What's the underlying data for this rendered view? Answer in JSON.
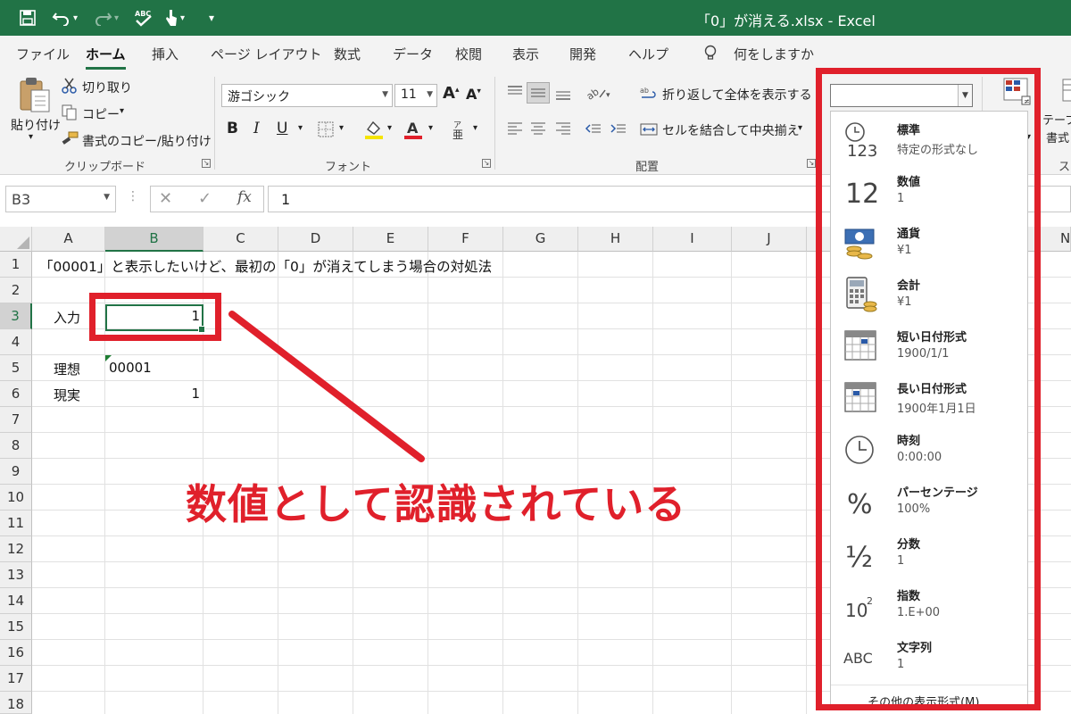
{
  "window": {
    "title": "「0」が消える.xlsx  -  Excel"
  },
  "quick_access": {
    "more": "▾"
  },
  "tabs": [
    "ファイル",
    "ホーム",
    "挿入",
    "ページ レイアウト",
    "数式",
    "データ",
    "校閲",
    "表示",
    "開発",
    "ヘルプ"
  ],
  "active_tab": "ホーム",
  "tell_me": "何をしますか",
  "ribbon": {
    "clipboard": {
      "paste": "貼り付け",
      "cut": "切り取り",
      "copy": "コピー",
      "format_painter": "書式のコピー/貼り付け",
      "label": "クリップボード"
    },
    "font": {
      "name": "游ゴシック",
      "size": "11",
      "bold": "B",
      "italic": "I",
      "underline": "U",
      "label": "フォント"
    },
    "alignment": {
      "wrap": "折り返して全体を表示する",
      "merge": "セルを結合して中央揃え",
      "label": "配置"
    },
    "styles": {
      "table_line1": "テーブ",
      "table_line2": "書式",
      "partial_label": "ス"
    }
  },
  "formula_bar": {
    "name_box": "B3",
    "cancel": "✕",
    "enter": "✓",
    "fx": "fx",
    "value": "1"
  },
  "sheet": {
    "columns": [
      "A",
      "B",
      "C",
      "D",
      "E",
      "F",
      "G",
      "H",
      "I",
      "J",
      "N"
    ],
    "rows": [
      "1",
      "2",
      "3",
      "4",
      "5",
      "6",
      "7",
      "8",
      "9",
      "10",
      "11",
      "12",
      "13",
      "14",
      "15",
      "16",
      "17",
      "18"
    ],
    "selected_column": "B",
    "selected_row": "3",
    "a1": "「00001」と表示したいけど、最初の「0」が消えてしまう場合の対処法",
    "a3": "入力",
    "b3": "1",
    "a5": "理想",
    "b5": "00001",
    "a6": "現実",
    "b6": "1"
  },
  "annotation": {
    "text": "数値として認識されている",
    "color": "#e0202b"
  },
  "number_format_menu": {
    "items": [
      {
        "icon": "clock-123-icon",
        "name": "標準",
        "example": "特定の形式なし"
      },
      {
        "icon": "number-12-icon",
        "name": "数値",
        "example": "1"
      },
      {
        "icon": "currency-icon",
        "name": "通貨",
        "example": "¥1"
      },
      {
        "icon": "accounting-icon",
        "name": "会計",
        "example": " ¥1"
      },
      {
        "icon": "calendar-short-icon",
        "name": "短い日付形式",
        "example": "1900/1/1"
      },
      {
        "icon": "calendar-long-icon",
        "name": "長い日付形式",
        "example": "1900年1月1日"
      },
      {
        "icon": "clock-icon",
        "name": "時刻",
        "example": "0:00:00"
      },
      {
        "icon": "percent-icon",
        "name": "パーセンテージ",
        "example": "100%"
      },
      {
        "icon": "fraction-icon",
        "name": "分数",
        "example": "1"
      },
      {
        "icon": "scientific-icon",
        "name": "指数",
        "example": "1.E+00"
      },
      {
        "icon": "text-abc-icon",
        "name": "文字列",
        "example": "1"
      }
    ],
    "more": "その他の表示形式(M)...",
    "glyphs": {
      "n12": "12",
      "n123": "123",
      "percent": "%",
      "fraction": "½",
      "ten": "10",
      "exp": "2",
      "abc": "ABC"
    }
  },
  "colors": {
    "excel_green": "#217346",
    "highlight_red": "#e0202b"
  }
}
